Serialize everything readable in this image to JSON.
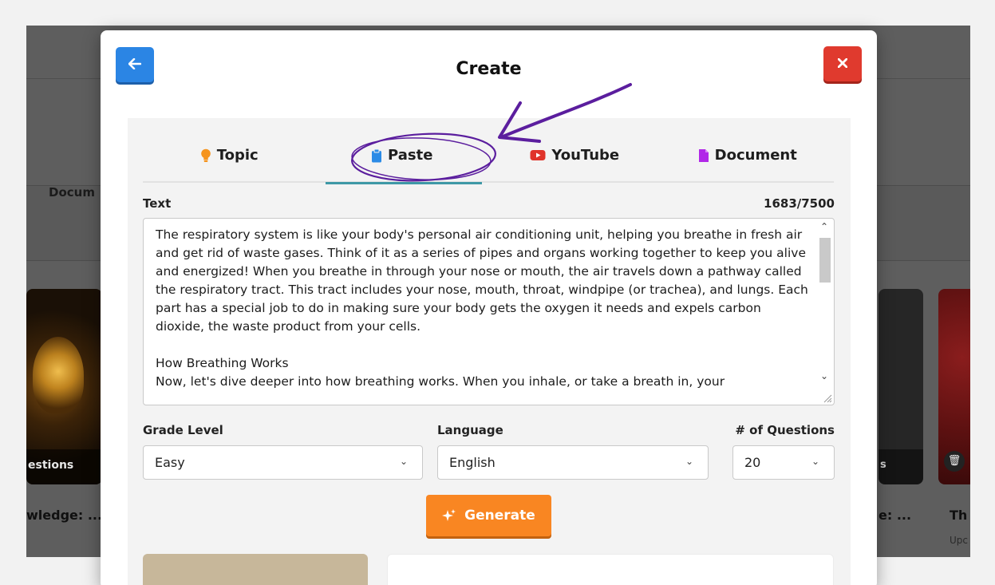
{
  "modal": {
    "title": "Create",
    "back_icon": "arrow-left-icon",
    "close_icon": "x-icon"
  },
  "tabs": [
    {
      "label": "Topic",
      "icon": "lightbulb-icon",
      "icon_color": "#f5941e"
    },
    {
      "label": "Paste",
      "icon": "clipboard-icon",
      "icon_color": "#2b8be6",
      "active": true
    },
    {
      "label": "YouTube",
      "icon": "youtube-icon",
      "icon_color": "#e0332a"
    },
    {
      "label": "Document",
      "icon": "file-icon",
      "icon_color": "#b128e8"
    }
  ],
  "text_field": {
    "label": "Text",
    "count": "1683/7500",
    "value": "The respiratory system is like your body's personal air conditioning unit, helping you breathe in fresh air and get rid of waste gases. Think of it as a series of pipes and organs working together to keep you alive and energized! When you breathe in through your nose or mouth, the air travels down a pathway called the respiratory tract. This tract includes your nose, mouth, throat, windpipe (or trachea), and lungs. Each part has a special job to do in making sure your body gets the oxygen it needs and expels carbon dioxide, the waste product from your cells.\n\nHow Breathing Works\nNow, let's dive deeper into how breathing works. When you inhale, or take a breath in, your"
  },
  "grade_level": {
    "label": "Grade Level",
    "value": "Easy"
  },
  "language": {
    "label": "Language",
    "value": "English"
  },
  "num_questions": {
    "label": "# of Questions",
    "value": "20"
  },
  "generate": {
    "label": "Generate",
    "icon": "sparkle-icon"
  },
  "background": {
    "tab_partial": "Docum",
    "card_left_label": "estions",
    "card_left_title": "wledge: ...",
    "card_right_label": "s",
    "card_right_title": "e: ...",
    "card_far_title": "Th",
    "card_far_sub": "Upc"
  },
  "colors": {
    "accent_blue": "#2b85e4",
    "close_red": "#e03a2e",
    "generate_orange": "#f98622",
    "active_tab_underline": "#3e98a6",
    "annotation_purple": "#5b1e9e"
  }
}
